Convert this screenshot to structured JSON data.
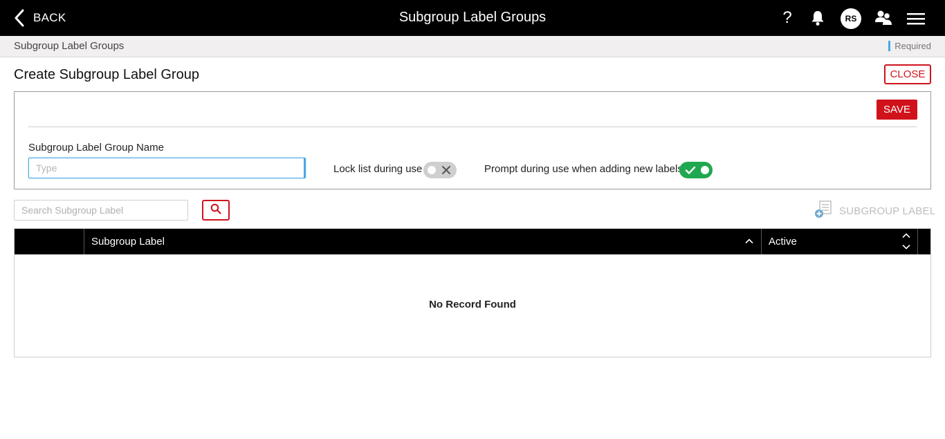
{
  "header": {
    "back_label": "BACK",
    "title": "Subgroup Label Groups",
    "help_symbol": "?",
    "avatar_initials": "RS",
    "icons": [
      "back-chevron-icon",
      "help-icon",
      "bell-icon",
      "users-icon",
      "hamburger-menu-icon"
    ]
  },
  "breadcrumb": {
    "current": "Subgroup Label Groups",
    "required_label": "Required"
  },
  "page": {
    "title": "Create Subgroup Label Group",
    "close_label": "CLOSE"
  },
  "form": {
    "save_label": "SAVE",
    "name_label": "Subgroup Label Group Name",
    "name_value": "",
    "name_placeholder": "Type",
    "lock_label": "Lock list during use",
    "lock_state": false,
    "prompt_label": "Prompt during use when adding new labels",
    "prompt_state": true
  },
  "search": {
    "placeholder": "Search Subgroup Label",
    "value": ""
  },
  "add_button": {
    "label": "SUBGROUP LABEL"
  },
  "table": {
    "columns": [
      "",
      "Subgroup Label",
      "Active"
    ],
    "rows": [],
    "empty_message": "No Record Found"
  },
  "colors": {
    "accent_red": "#d0121b",
    "toggle_on": "#1fa84f",
    "focus_blue": "#4aa8e0",
    "header_bg": "#000000"
  }
}
